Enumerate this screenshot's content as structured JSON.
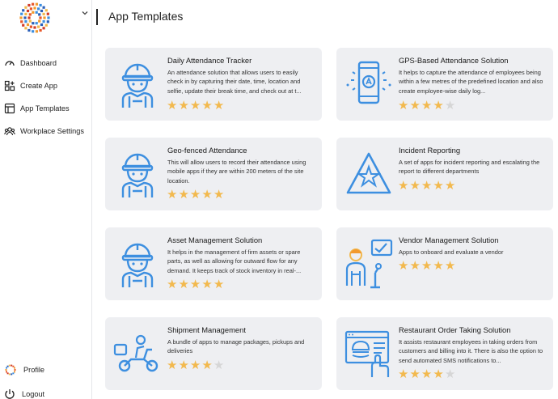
{
  "sidebar": {
    "items": [
      {
        "label": "Dashboard",
        "icon": "dashboard-icon"
      },
      {
        "label": "Create App",
        "icon": "create-app-icon"
      },
      {
        "label": "App Templates",
        "icon": "templates-icon"
      },
      {
        "label": "Workplace Settings",
        "icon": "users-icon"
      }
    ],
    "profile_label": "Profile",
    "logout_label": "Logout"
  },
  "page": {
    "title": "App Templates"
  },
  "colors": {
    "accent": "#3d8fe0",
    "star_on": "#f2b94e",
    "star_off": "#d6d6d6",
    "card_bg": "#eeeff2"
  },
  "templates": [
    {
      "title": "Daily Attendance Tracker",
      "description": "An attendance solution that allows users to easily check in by capturing their date, time, location and selfie, update their break time, and check out at t...",
      "rating": 5,
      "icon": "worker-helmet-icon"
    },
    {
      "title": "GPS-Based Attendance Solution",
      "description": "It helps to capture the attendance of employees being within a few metres of the predefined location and also create employee-wise daily log...",
      "rating": 4,
      "icon": "gps-phone-icon"
    },
    {
      "title": "Geo-fenced Attendance",
      "description": "This will allow users to record their attendance using mobile apps if they are within 200 meters of the site location.",
      "rating": 5,
      "icon": "worker-helmet-icon"
    },
    {
      "title": "Incident Reporting",
      "description": "A set of apps for incident reporting and escalating the report to different departments",
      "rating": 5,
      "icon": "warning-triangle-icon"
    },
    {
      "title": "Asset Management Solution",
      "description": "It helps in the management of firm assets or spare parts, as well as allowing for outward flow for any demand. It keeps track of stock inventory in real-...",
      "rating": 5,
      "icon": "worker-helmet-icon"
    },
    {
      "title": "Vendor Management Solution",
      "description": "Apps to onboard and evaluate a vendor",
      "rating": 5,
      "icon": "vendor-presenter-icon"
    },
    {
      "title": "Shipment Management",
      "description": "A bundle of apps to manage packages, pickups and deliveries",
      "rating": 4,
      "icon": "delivery-scooter-icon"
    },
    {
      "title": "Restaurant Order Taking Solution",
      "description": "It assists restaurant employees in taking orders from customers and billing into it. There is also the option to send automated SMS notifications to...",
      "rating": 4,
      "icon": "burger-order-icon"
    }
  ]
}
